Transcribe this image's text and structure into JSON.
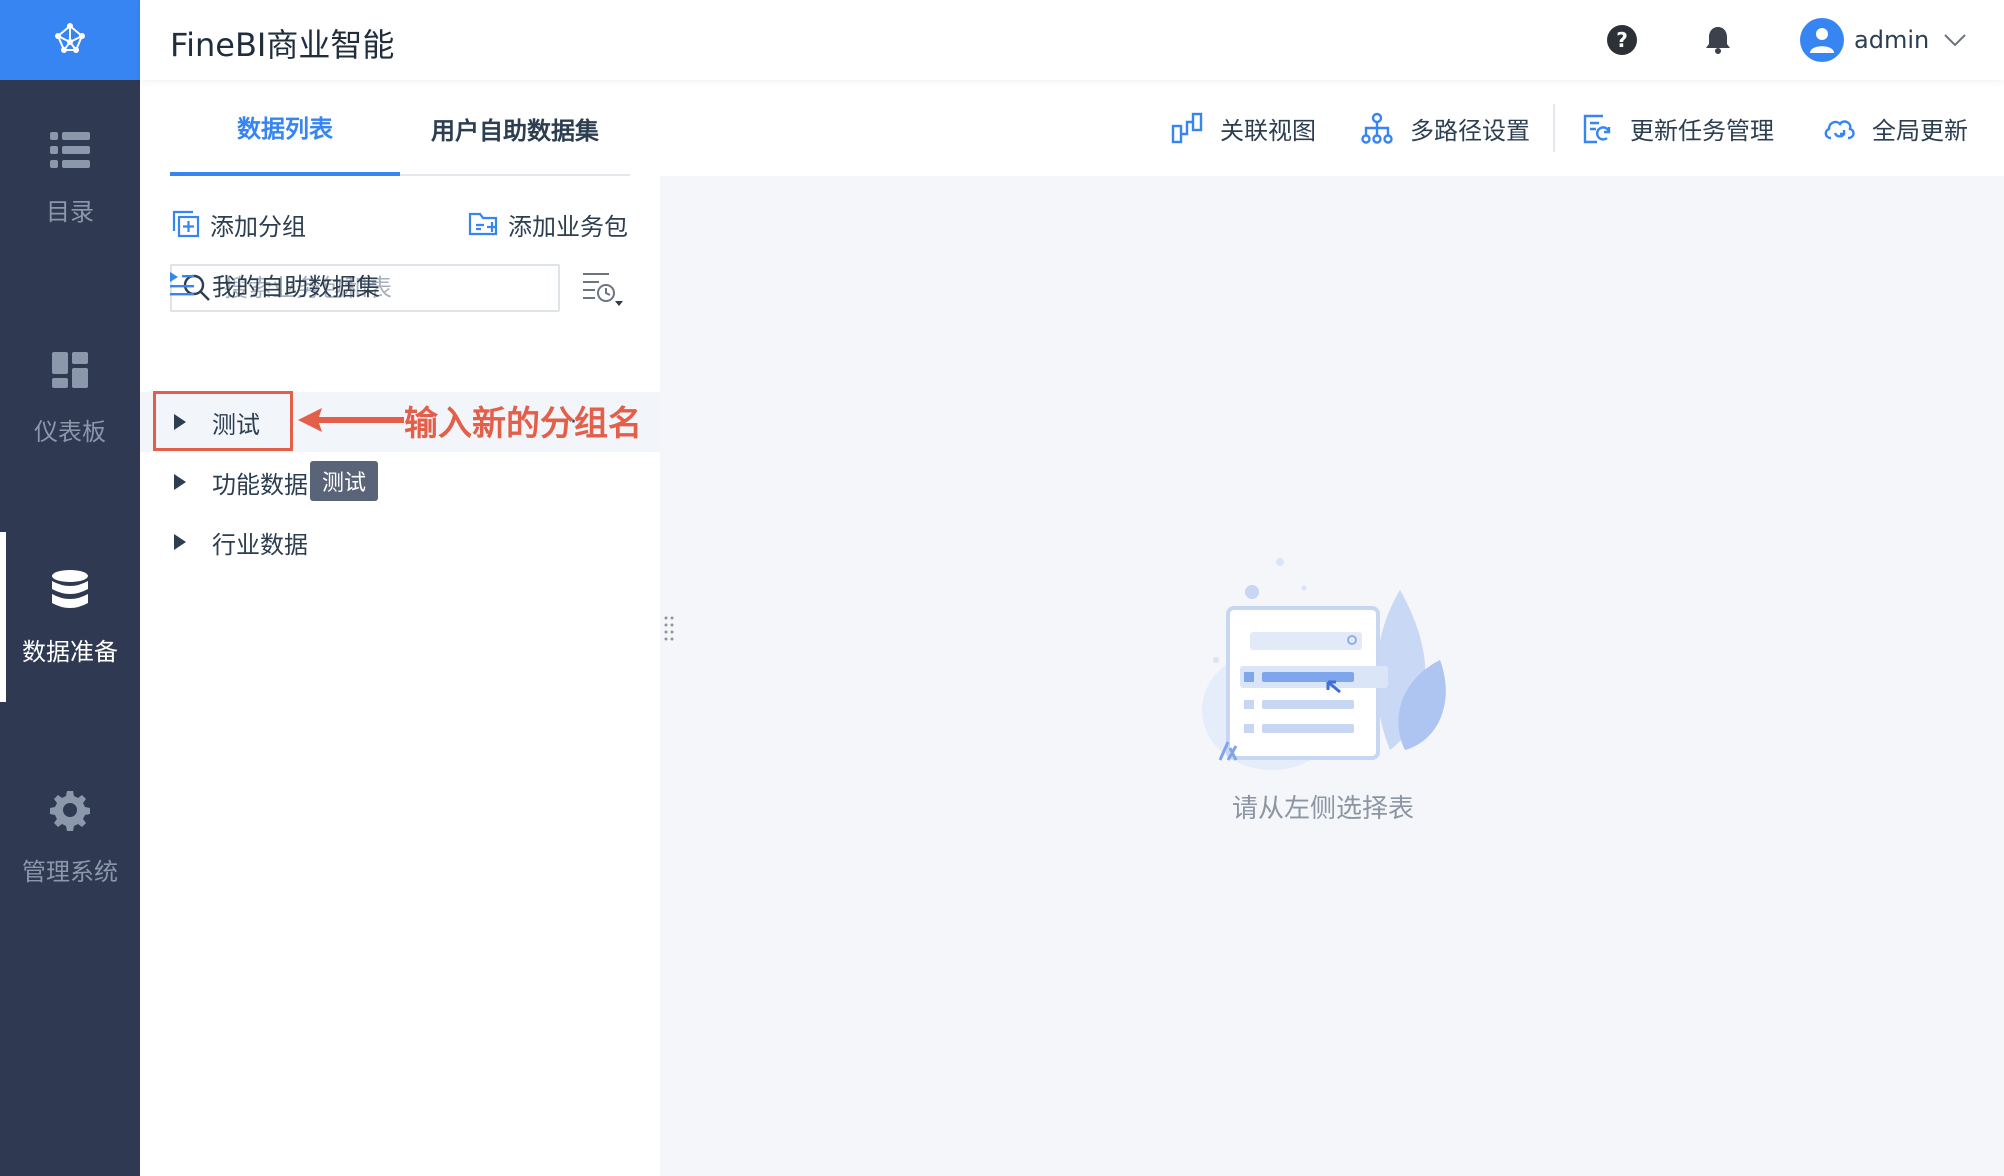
{
  "app": {
    "title": "FineBI商业智能"
  },
  "nav": {
    "items": [
      {
        "label": "目录",
        "icon": "list-icon"
      },
      {
        "label": "仪表板",
        "icon": "dashboard-icon"
      },
      {
        "label": "数据准备",
        "icon": "database-icon",
        "active": true
      },
      {
        "label": "管理系统",
        "icon": "gear-icon"
      }
    ]
  },
  "header": {
    "username": "admin"
  },
  "tabs": [
    {
      "label": "数据列表",
      "active": true
    },
    {
      "label": "用户自助数据集"
    }
  ],
  "toolbar": {
    "relation_view": "关联视图",
    "multipath": "多路径设置",
    "update_task": "更新任务管理",
    "global_update": "全局更新"
  },
  "panel": {
    "add_group": "添加分组",
    "add_package": "添加业务包",
    "search_placeholder": "搜索业务包和表",
    "my_dataset": "我的自助数据集",
    "groups": [
      {
        "label": "测试"
      },
      {
        "label": "功能数据"
      },
      {
        "label": "行业数据"
      }
    ],
    "more": "···",
    "tooltip": "测试"
  },
  "annotation": {
    "text": "输入新的分组名"
  },
  "main": {
    "empty_text": "请从左侧选择表"
  },
  "colors": {
    "accent": "#3685f2",
    "rail": "#2f3a52",
    "annotation": "#e35f4a"
  }
}
